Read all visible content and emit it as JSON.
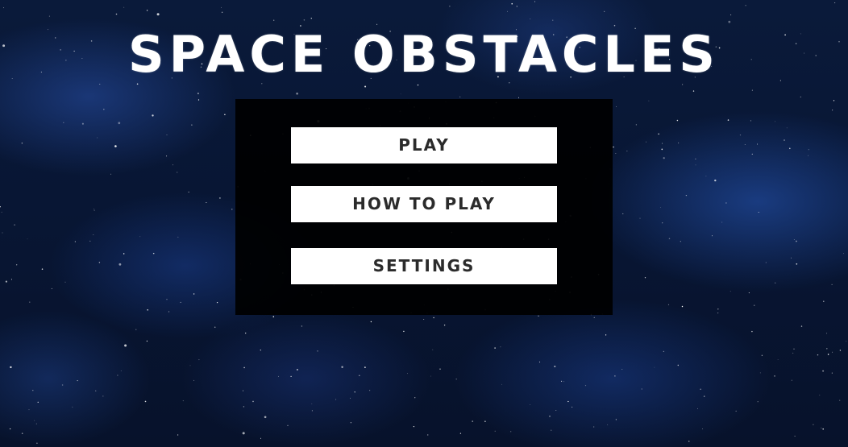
{
  "game": {
    "title": "SPACE OBSTACLES"
  },
  "menu": {
    "play_label": "PLAY",
    "how_to_play_label": "HOW TO PLAY",
    "settings_label": "SETTINGS"
  },
  "colors": {
    "background": "#081634",
    "nebula": "#2850aa",
    "panel": "#000000",
    "button": "#ffffff",
    "button_text": "#2b2b2b",
    "title_text": "#ffffff"
  }
}
